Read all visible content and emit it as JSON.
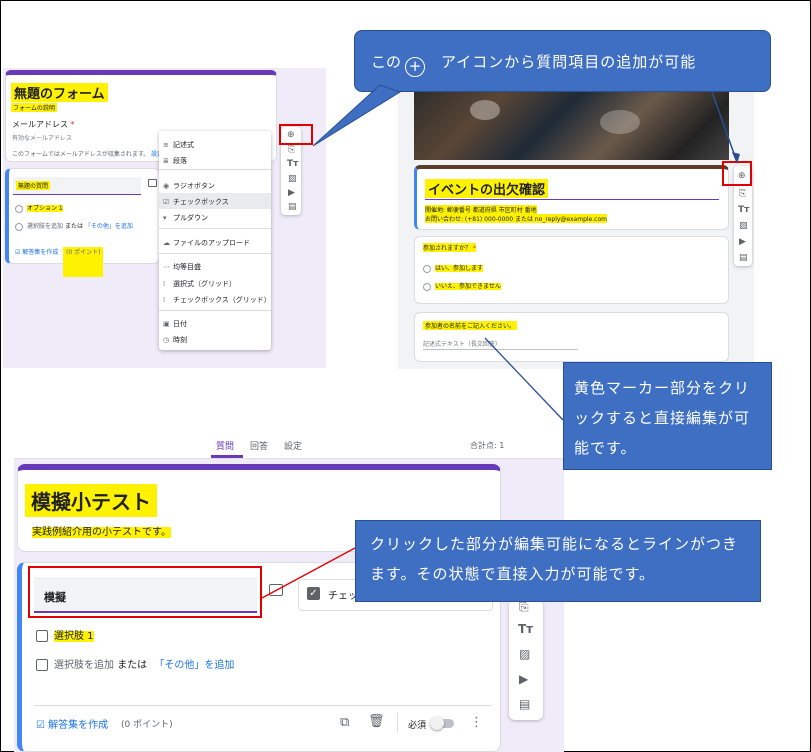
{
  "callouts": {
    "top": [
      "この",
      "アイコンから質問項目の追加が可能"
    ],
    "right": "黄色マーカー部分をクリックすると直接編集が可能です。",
    "bottom": "クリックした部分が編集可能になるとラインがつきます。その状態で直接入力が可能です。"
  },
  "left_form": {
    "title": "無題のフォーム",
    "description": "フォームの説明",
    "email_label": "メールアドレス",
    "email_required": "*",
    "email_placeholder": "有効なメールアドレス",
    "email_note": "このフォームではメールアドレスが収集されます。",
    "email_note_link": "設定を変更",
    "question_title": "無題の質問",
    "option1": "オプション 1",
    "add_option": "選択肢を追加",
    "or": "または",
    "other": "「その他」を追加",
    "answer_key": "解答集を作成",
    "points": "(0 ポイント)",
    "menu": [
      "記述式",
      "段落",
      "ラジオボタン",
      "チェックボックス",
      "プルダウン",
      "ファイルのアップロード",
      "均等目盛",
      "選択式（グリッド）",
      "チェックボックス（グリッド）",
      "日付",
      "時刻"
    ]
  },
  "right_form": {
    "title": "イベントの出欠確認",
    "info1": "開催地: 郵便番号 都道府県 市区町村 番地",
    "info2": "お問い合わせ: (+81) 000-0000 または no_reply@example.com",
    "q1": "参加されますか？",
    "q1_required": "*",
    "q1_opt1": "はい、参加します",
    "q1_opt2": "いいえ、参加できません",
    "q2": "参加者の名前をご記入ください。",
    "q2_placeholder": "記述式テキスト（長文回答）"
  },
  "bottom_form": {
    "tabs": [
      "質問",
      "回答",
      "設定"
    ],
    "total_points": "合計点: 1",
    "title": "模擬小テスト",
    "description": "実践例紹介用の小テストです。",
    "question_title": "模擬",
    "type_label": "チェッ",
    "option1": "選択肢 1",
    "add_option": "選択肢を追加",
    "or": "または",
    "other": "「その他」を追加",
    "answer_key": "解答集を作成",
    "points": "(0 ポイント)",
    "required": "必須"
  },
  "colors": {
    "accent": "#673ab7",
    "callout": "#3f6fc2",
    "highlight": "#fff200",
    "red": "#e00000",
    "blue": "#1a73e8"
  }
}
